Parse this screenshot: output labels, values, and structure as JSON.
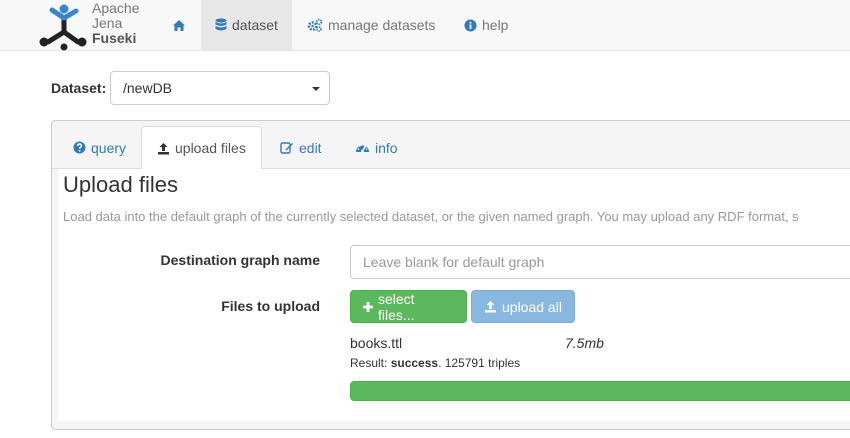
{
  "brand": {
    "line1": "Apache",
    "line2": "Jena",
    "line3": "Fuseki"
  },
  "nav": {
    "home_icon": "home-icon",
    "items": [
      {
        "label": "dataset",
        "icon": "database-icon",
        "active": true
      },
      {
        "label": "manage datasets",
        "icon": "cogs-icon",
        "active": false
      },
      {
        "label": "help",
        "icon": "info-circle-icon",
        "active": false
      }
    ]
  },
  "dataset": {
    "label": "Dataset:",
    "selected": "/newDB"
  },
  "tabs": [
    {
      "label": "query",
      "icon": "question-circle-icon",
      "active": false
    },
    {
      "label": "upload files",
      "icon": "upload-icon",
      "active": true
    },
    {
      "label": "edit",
      "icon": "edit-icon",
      "active": false
    },
    {
      "label": "info",
      "icon": "dashboard-icon",
      "active": false
    }
  ],
  "upload": {
    "title": "Upload files",
    "description": "Load data into the default graph of the currently selected dataset, or the given named graph. You may upload any RDF format, s",
    "dest_label": "Destination graph name",
    "dest_placeholder": "Leave blank for default graph",
    "dest_value": "",
    "files_label": "Files to upload",
    "select_button": "select files...",
    "upload_button": "upload all",
    "file": {
      "name": "books.ttl",
      "size": "7.5mb",
      "result_prefix": "Result: ",
      "result_status": "success",
      "result_suffix": ". 125791 triples",
      "progress": 1.0
    }
  },
  "colors": {
    "link": "#337ab7",
    "success": "#5cb85c",
    "primary_disabled": "#88b7e0"
  }
}
